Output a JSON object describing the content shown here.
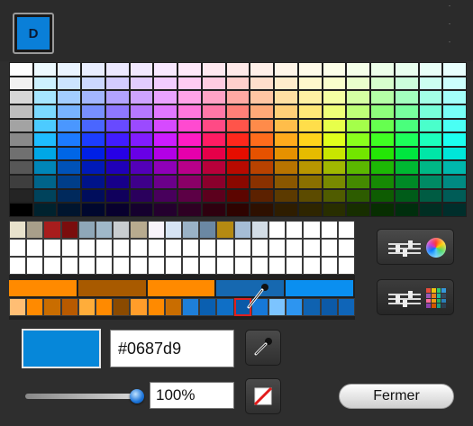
{
  "document_button": {
    "label": "D",
    "color": "#0a7fd8"
  },
  "palette": {
    "rows": [
      [
        "#ffffff",
        "#eefaff",
        "#eaf4ff",
        "#e9eeff",
        "#ece9ff",
        "#f2e9ff",
        "#f9e9ff",
        "#ffe9fa",
        "#ffe9f0",
        "#ffeae9",
        "#fff0e9",
        "#fff6e9",
        "#fffbe9",
        "#fdffe9",
        "#f5ffe9",
        "#edffea",
        "#e9ffef",
        "#e9fff8",
        "#e9fffe"
      ],
      [
        "#f1f1f1",
        "#cdf1ff",
        "#cce4ff",
        "#ccd8ff",
        "#d3ccff",
        "#e2ccff",
        "#f2ccff",
        "#ffccf3",
        "#ffcce1",
        "#ffcfcc",
        "#ffdfcc",
        "#ffedcc",
        "#fff8cc",
        "#faffcc",
        "#e9ffcc",
        "#d7ffcd",
        "#ccffdc",
        "#ccfff1",
        "#ccfffd"
      ],
      [
        "#d7d7d7",
        "#a6e6ff",
        "#a3cdff",
        "#a3b6ff",
        "#b2a3ff",
        "#cda3ff",
        "#eaa3ff",
        "#ffa3e8",
        "#ffa3c6",
        "#ffa9a3",
        "#ffc6a3",
        "#ffe0a3",
        "#fff1a3",
        "#f5ffa3",
        "#d5ffa3",
        "#b4ffa6",
        "#a3ffbe",
        "#a3ffe6",
        "#a3fffa"
      ],
      [
        "#bdbdbd",
        "#7bd9ff",
        "#78b3ff",
        "#788fff",
        "#8e78ff",
        "#b578ff",
        "#e078ff",
        "#ff78dc",
        "#ff78a7",
        "#ff8078",
        "#ffa978",
        "#ffcf78",
        "#ffe878",
        "#eeff78",
        "#bdff78",
        "#8eff7c",
        "#78ff9e",
        "#78ffd9",
        "#78fff7"
      ],
      [
        "#a3a3a3",
        "#4ccbff",
        "#4a97ff",
        "#4a66ff",
        "#684aff",
        "#9b4aff",
        "#d64aff",
        "#ff4ad0",
        "#ff4a85",
        "#ff544a",
        "#ff8b4a",
        "#ffbd4a",
        "#ffde4a",
        "#e7ff4a",
        "#a4ff4a",
        "#66ff4f",
        "#4aff7c",
        "#4affcb",
        "#4afff4"
      ],
      [
        "#898989",
        "#1ebdff",
        "#1c7bff",
        "#1c3dff",
        "#411cff",
        "#811cff",
        "#cc1cff",
        "#ff1cc4",
        "#ff1c63",
        "#ff281c",
        "#ff6c1c",
        "#ffab1c",
        "#ffd41c",
        "#e0ff1c",
        "#8aff1c",
        "#3fff22",
        "#1cff5a",
        "#1cffbd",
        "#1cfff0"
      ],
      [
        "#707070",
        "#00a7e6",
        "#0066e6",
        "#0020e6",
        "#2700e6",
        "#6800e6",
        "#b300e6",
        "#e600ac",
        "#e60049",
        "#e60d00",
        "#e65200",
        "#e69100",
        "#e6bb00",
        "#c8e600",
        "#72e600",
        "#24e606",
        "#00e63f",
        "#00e6a7",
        "#00e6d9"
      ],
      [
        "#575757",
        "#0086b8",
        "#0052b8",
        "#001ab8",
        "#1f00b8",
        "#5300b8",
        "#8f00b8",
        "#b8008a",
        "#b8003a",
        "#b80a00",
        "#b84200",
        "#b87400",
        "#b89600",
        "#a0b800",
        "#5bb800",
        "#1db805",
        "#00b832",
        "#00b886",
        "#00b8ad"
      ],
      [
        "#3e3e3e",
        "#00648a",
        "#003e8a",
        "#00138a",
        "#17008a",
        "#3e008a",
        "#6b008a",
        "#8a0067",
        "#8a002c",
        "#8a0800",
        "#8a3100",
        "#8a5700",
        "#8a7000",
        "#788a00",
        "#448a00",
        "#168a04",
        "#008a26",
        "#008a64",
        "#008a82"
      ],
      [
        "#242424",
        "#00435c",
        "#00295c",
        "#000d5c",
        "#10005c",
        "#2a005c",
        "#48005c",
        "#5c0045",
        "#5c001d",
        "#5c0500",
        "#5c2100",
        "#5c3a00",
        "#5c4b00",
        "#505c00",
        "#2d5c00",
        "#0e5c02",
        "#005c19",
        "#005c43",
        "#005c57"
      ],
      [
        "#000000",
        "#00222e",
        "#00152e",
        "#00072e",
        "#08002e",
        "#15002e",
        "#24002e",
        "#2e0023",
        "#2e000f",
        "#2e0300",
        "#2e1000",
        "#2e1d00",
        "#2e2500",
        "#282e00",
        "#172e00",
        "#072e01",
        "#002e0d",
        "#002e22",
        "#002e2b"
      ]
    ]
  },
  "recent_swatches": {
    "row1": [
      "#e8e2cc",
      "#a89f8a",
      "#a81d1d",
      "#7a0d0d",
      "#8fa7b8",
      "#a0b8c9",
      "#c9cdd0",
      "#b8ab8f",
      "#f8f3fa",
      "#d6e3f3",
      "#9ab2c6",
      "#6b88a3",
      "#b58a12",
      "#a5bdd6",
      "#d3dde6",
      "#ffffff",
      "#ffffff",
      "#ffffff",
      "#ffffff",
      "#ffffff"
    ],
    "row2": [
      "#ffffff",
      "#ffffff",
      "#ffffff",
      "#ffffff",
      "#ffffff",
      "#ffffff",
      "#ffffff",
      "#ffffff",
      "#ffffff",
      "#ffffff",
      "#ffffff",
      "#ffffff",
      "#ffffff",
      "#ffffff",
      "#ffffff",
      "#ffffff",
      "#ffffff",
      "#ffffff",
      "#ffffff",
      "#ffffff"
    ],
    "row3": [
      "#ffffff",
      "#ffffff",
      "#ffffff",
      "#ffffff",
      "#ffffff",
      "#ffffff",
      "#ffffff",
      "#ffffff",
      "#ffffff",
      "#ffffff",
      "#ffffff",
      "#ffffff",
      "#ffffff",
      "#ffffff",
      "#ffffff",
      "#ffffff",
      "#ffffff",
      "#ffffff",
      "#ffffff",
      "#ffffff"
    ],
    "band": [
      "#ff8a00",
      "#a85a00",
      "#ff8a00",
      "#1668b0",
      "#0a8ff0"
    ],
    "band_bottom": [
      "#ffbe74",
      "#ff8a00",
      "#c96d00",
      "#b85a00",
      "#ffad3a",
      "#ff8a00",
      "#8a4a00",
      "#ff9d2a",
      "#ff8a00",
      "#c96d00",
      "#1e7fd9",
      "#0a5fb0",
      "#0f6fc6",
      "#0a5aa8",
      "#1678d8",
      "#7cc4ff",
      "#2d95f0",
      "#0f62b0",
      "#0c5aa8",
      "#0f65b8"
    ],
    "selected_index": 13
  },
  "tools": {
    "sliders_wheel_label": "sliders-and-color-wheel",
    "sliders_grid_label": "sliders-and-swatch-grid"
  },
  "current_color": "#0687d9",
  "hex_value": "#0687d9",
  "opacity_value": "100%",
  "opacity_level": 1.0,
  "close_label": "Fermer"
}
